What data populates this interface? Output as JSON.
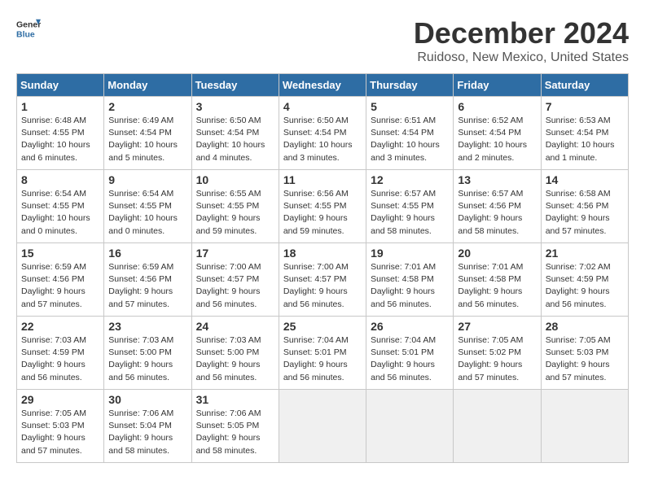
{
  "header": {
    "logo_general": "General",
    "logo_blue": "Blue",
    "month_title": "December 2024",
    "location": "Ruidoso, New Mexico, United States"
  },
  "weekdays": [
    "Sunday",
    "Monday",
    "Tuesday",
    "Wednesday",
    "Thursday",
    "Friday",
    "Saturday"
  ],
  "weeks": [
    [
      {
        "day": "1",
        "info": "Sunrise: 6:48 AM\nSunset: 4:55 PM\nDaylight: 10 hours\nand 6 minutes."
      },
      {
        "day": "2",
        "info": "Sunrise: 6:49 AM\nSunset: 4:54 PM\nDaylight: 10 hours\nand 5 minutes."
      },
      {
        "day": "3",
        "info": "Sunrise: 6:50 AM\nSunset: 4:54 PM\nDaylight: 10 hours\nand 4 minutes."
      },
      {
        "day": "4",
        "info": "Sunrise: 6:50 AM\nSunset: 4:54 PM\nDaylight: 10 hours\nand 3 minutes."
      },
      {
        "day": "5",
        "info": "Sunrise: 6:51 AM\nSunset: 4:54 PM\nDaylight: 10 hours\nand 3 minutes."
      },
      {
        "day": "6",
        "info": "Sunrise: 6:52 AM\nSunset: 4:54 PM\nDaylight: 10 hours\nand 2 minutes."
      },
      {
        "day": "7",
        "info": "Sunrise: 6:53 AM\nSunset: 4:54 PM\nDaylight: 10 hours\nand 1 minute."
      }
    ],
    [
      {
        "day": "8",
        "info": "Sunrise: 6:54 AM\nSunset: 4:55 PM\nDaylight: 10 hours\nand 0 minutes."
      },
      {
        "day": "9",
        "info": "Sunrise: 6:54 AM\nSunset: 4:55 PM\nDaylight: 10 hours\nand 0 minutes."
      },
      {
        "day": "10",
        "info": "Sunrise: 6:55 AM\nSunset: 4:55 PM\nDaylight: 9 hours\nand 59 minutes."
      },
      {
        "day": "11",
        "info": "Sunrise: 6:56 AM\nSunset: 4:55 PM\nDaylight: 9 hours\nand 59 minutes."
      },
      {
        "day": "12",
        "info": "Sunrise: 6:57 AM\nSunset: 4:55 PM\nDaylight: 9 hours\nand 58 minutes."
      },
      {
        "day": "13",
        "info": "Sunrise: 6:57 AM\nSunset: 4:56 PM\nDaylight: 9 hours\nand 58 minutes."
      },
      {
        "day": "14",
        "info": "Sunrise: 6:58 AM\nSunset: 4:56 PM\nDaylight: 9 hours\nand 57 minutes."
      }
    ],
    [
      {
        "day": "15",
        "info": "Sunrise: 6:59 AM\nSunset: 4:56 PM\nDaylight: 9 hours\nand 57 minutes."
      },
      {
        "day": "16",
        "info": "Sunrise: 6:59 AM\nSunset: 4:56 PM\nDaylight: 9 hours\nand 57 minutes."
      },
      {
        "day": "17",
        "info": "Sunrise: 7:00 AM\nSunset: 4:57 PM\nDaylight: 9 hours\nand 56 minutes."
      },
      {
        "day": "18",
        "info": "Sunrise: 7:00 AM\nSunset: 4:57 PM\nDaylight: 9 hours\nand 56 minutes."
      },
      {
        "day": "19",
        "info": "Sunrise: 7:01 AM\nSunset: 4:58 PM\nDaylight: 9 hours\nand 56 minutes."
      },
      {
        "day": "20",
        "info": "Sunrise: 7:01 AM\nSunset: 4:58 PM\nDaylight: 9 hours\nand 56 minutes."
      },
      {
        "day": "21",
        "info": "Sunrise: 7:02 AM\nSunset: 4:59 PM\nDaylight: 9 hours\nand 56 minutes."
      }
    ],
    [
      {
        "day": "22",
        "info": "Sunrise: 7:03 AM\nSunset: 4:59 PM\nDaylight: 9 hours\nand 56 minutes."
      },
      {
        "day": "23",
        "info": "Sunrise: 7:03 AM\nSunset: 5:00 PM\nDaylight: 9 hours\nand 56 minutes."
      },
      {
        "day": "24",
        "info": "Sunrise: 7:03 AM\nSunset: 5:00 PM\nDaylight: 9 hours\nand 56 minutes."
      },
      {
        "day": "25",
        "info": "Sunrise: 7:04 AM\nSunset: 5:01 PM\nDaylight: 9 hours\nand 56 minutes."
      },
      {
        "day": "26",
        "info": "Sunrise: 7:04 AM\nSunset: 5:01 PM\nDaylight: 9 hours\nand 56 minutes."
      },
      {
        "day": "27",
        "info": "Sunrise: 7:05 AM\nSunset: 5:02 PM\nDaylight: 9 hours\nand 57 minutes."
      },
      {
        "day": "28",
        "info": "Sunrise: 7:05 AM\nSunset: 5:03 PM\nDaylight: 9 hours\nand 57 minutes."
      }
    ],
    [
      {
        "day": "29",
        "info": "Sunrise: 7:05 AM\nSunset: 5:03 PM\nDaylight: 9 hours\nand 57 minutes."
      },
      {
        "day": "30",
        "info": "Sunrise: 7:06 AM\nSunset: 5:04 PM\nDaylight: 9 hours\nand 58 minutes."
      },
      {
        "day": "31",
        "info": "Sunrise: 7:06 AM\nSunset: 5:05 PM\nDaylight: 9 hours\nand 58 minutes."
      },
      null,
      null,
      null,
      null
    ]
  ]
}
